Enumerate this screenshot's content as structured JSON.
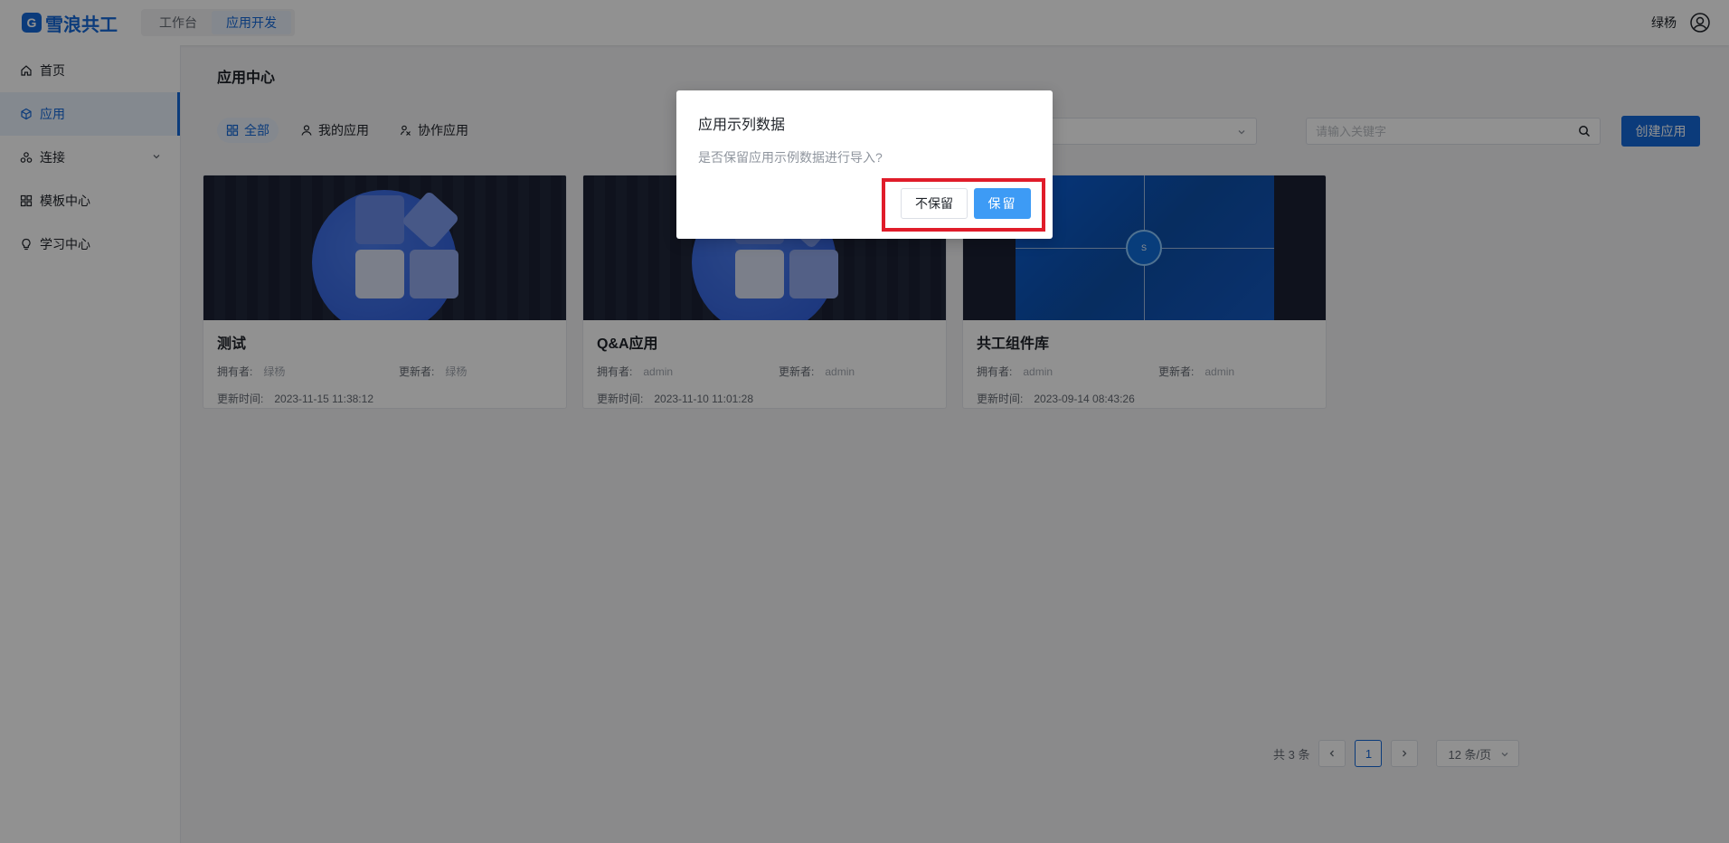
{
  "header": {
    "brand": "雪浪共工",
    "brand_mark": "G",
    "nav": [
      {
        "label": "工作台",
        "active": false
      },
      {
        "label": "应用开发",
        "active": true
      }
    ],
    "username": "绿杨",
    "user_icon": "user-circle-icon"
  },
  "sidebar": {
    "items": [
      {
        "label": "首页",
        "icon": "home-icon",
        "active": false
      },
      {
        "label": "应用",
        "icon": "cube-icon",
        "active": true
      },
      {
        "label": "连接",
        "icon": "connection-icon",
        "active": false,
        "expandable": true
      },
      {
        "label": "模板中心",
        "icon": "grid-icon",
        "active": false
      },
      {
        "label": "学习中心",
        "icon": "lightbulb-icon",
        "active": false
      }
    ]
  },
  "main": {
    "title": "应用中心",
    "tabs": [
      {
        "label": "全部",
        "icon": "grid-icon",
        "active": true
      },
      {
        "label": "我的应用",
        "icon": "user-icon",
        "active": false
      },
      {
        "label": "协作应用",
        "icon": "collaborators-icon",
        "active": false
      }
    ],
    "search_placeholder": "请输入关键字",
    "create_label": "创建应用"
  },
  "cards": [
    {
      "title": "测试",
      "owner_label": "拥有者:",
      "owner": "绿杨",
      "updater_label": "更新者:",
      "updater": "绿杨",
      "time_label": "更新时间:",
      "time": "2023-11-15 11:38:12"
    },
    {
      "title": "Q&A应用",
      "owner_label": "拥有者:",
      "owner": "admin",
      "updater_label": "更新者:",
      "updater": "admin",
      "time_label": "更新时间:",
      "time": "2023-11-10 11:01:28"
    },
    {
      "title": "共工组件库",
      "owner_label": "拥有者:",
      "owner": "admin",
      "updater_label": "更新者:",
      "updater": "admin",
      "time_label": "更新时间:",
      "time": "2023-09-14 08:43:26"
    }
  ],
  "pagination": {
    "total": "共 3 条",
    "current_page": "1",
    "page_size": "12 条/页"
  },
  "modal": {
    "title": "应用示列数据",
    "message": "是否保留应用示例数据进行导入?",
    "cancel_label": "不保留",
    "ok_label": "保留"
  },
  "colors": {
    "primary": "#1468d8",
    "highlight": "#e01c2a",
    "ok_button": "#3d9bf5"
  }
}
